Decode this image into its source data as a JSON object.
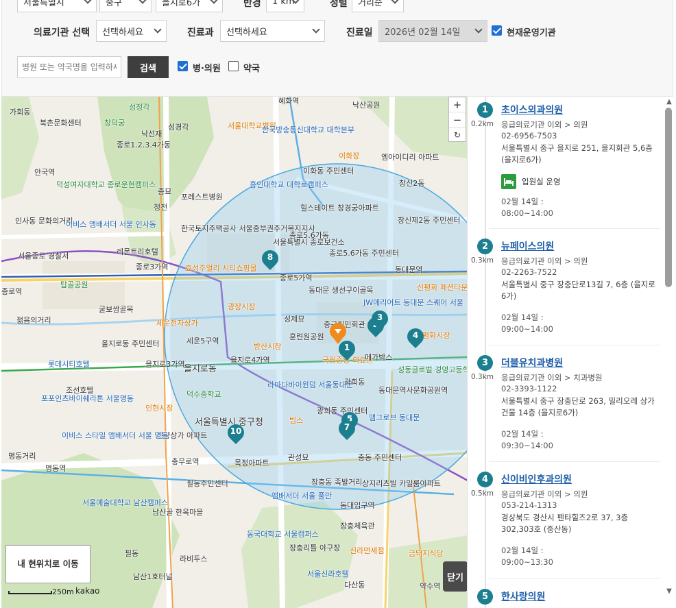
{
  "filters": {
    "region_city": "서울특별시",
    "region_district": "중구",
    "region_dong": "을지로6가",
    "radius_label": "반경",
    "radius_value": "1 km",
    "sort_label": "정렬",
    "sort_value": "거리순",
    "institution_label": "의료기관 선택",
    "institution_value": "선택하세요",
    "department_label": "진료과",
    "department_value": "선택하세요",
    "date_label": "진료일",
    "date_value": "2026년 02월 14일",
    "open_now_label": "현재운영기관",
    "open_now_checked": true,
    "search_placeholder": "병원 또는 약국명을 입력하세요",
    "search_button": "검색",
    "hospital_label": "병·의원",
    "hospital_checked": true,
    "pharmacy_label": "약국",
    "pharmacy_checked": false
  },
  "map": {
    "zoom_in": "+",
    "zoom_out": "−",
    "reset": "↻",
    "my_location": "내 현위치로 이동",
    "scale": "250m",
    "provider": "kakao",
    "close": "닫기",
    "labels": [
      "가회동",
      "북촌문화센터",
      "성정각",
      "창덕궁",
      "낙선재",
      "성경각",
      "서울대학교병원",
      "한국방송통신대학교 대학본부",
      "혜화역",
      "낙산공원",
      "종로1.2.3.4가동",
      "안국역",
      "덕성여자대학교 종로운현캠퍼스",
      "종묘",
      "포레스트병원",
      "정전",
      "이화동 주민센터",
      "이화장",
      "엠아이디리 아파트",
      "창신2동",
      "흥인대학교 대학로캠퍼스",
      "힐스테이트 창경궁아파트",
      "인사동 문화의거리",
      "이비스 앰배서더 서울 인사동",
      "한국토지주택공사 서울중부권주거복지지사",
      "종로5.6가동",
      "서울특별시 종로보건소",
      "종로5.6가동 주민센터",
      "창신제2동 주민센터",
      "서울종로 경찰서",
      "레몬트리호텔",
      "종로3가역",
      "효성주얼리 시티쇼핑몰",
      "종로5가역",
      "동대문역",
      "탑골공원",
      "굴보쌈골목",
      "동대문 생선구이골목",
      "광장시장",
      "JW메리어트 동대문 스퀘어 서울",
      "신평화 패션타운",
      "젊음의거리",
      "세운전자상가",
      "성제묘",
      "종로역",
      "중구립민회관",
      "평화시장",
      "세운5구역",
      "방산시장",
      "훈련원공원",
      "을지로동 주민센터",
      "을지로3가역",
      "을지로4가역",
      "국립중앙 의료원",
      "메가박스",
      "롯데시티호텔",
      "조선호텔",
      "포포인츠바이쉐라톤 서울명동",
      "을지로동",
      "라마다바이윈덤 서울동대문",
      "광희동",
      "동대문역사문화공원역",
      "성동글로벌 경영고등학교",
      "덕수중학교",
      "인현시장",
      "서울특별시 중구청",
      "진양상가 아파트",
      "빕스",
      "광희동 주민센터",
      "앰그로브 동대문",
      "명동거리",
      "이비스 스타일 앰배서더 서울 명동",
      "충무로역",
      "관성묘",
      "목정아파트",
      "충동 주민센터",
      "명동역",
      "필동주민센터",
      "상지리츠빌 카일룸아파트",
      "장충동 족발거리",
      "동대입구역",
      "서울예술대학교 남산캠퍼스",
      "남산골 한옥마을",
      "앰배서더 서울 풀만",
      "동국대학교 서울캠퍼스",
      "장충체육관",
      "장충리틀 야구장",
      "신라면세점",
      "금돼지식당",
      "필동",
      "라비두스",
      "남산1호터널",
      "다산동",
      "약수역",
      "서울신라호텔"
    ]
  },
  "results": [
    {
      "index": "1",
      "distance": "0.2km",
      "name": "초이스외과의원",
      "category": "응급의료기관 이외 > 의원",
      "phone": "02-6956-7503",
      "address": "서울특별시 중구 을지로 251, 을지회관 5,6층 (을지로6가)",
      "inpatient": "입원실 운영",
      "hours_date": "02월 14일 :",
      "hours": "08:00~14:00"
    },
    {
      "index": "2",
      "distance": "0.3km",
      "name": "뉴페이스의원",
      "category": "응급의료기관 이외 > 의원",
      "phone": "02-2263-7522",
      "address": "서울특별시 중구 장충단로13길 7, 6층 (을지로6가)",
      "hours_date": "02월 14일 :",
      "hours": "09:00~14:00"
    },
    {
      "index": "3",
      "distance": "0.3km",
      "name": "더블유치과병원",
      "category": "응급의료기관 이외 > 치과병원",
      "phone": "02-3393-1122",
      "address": "서울특별시 중구 장충단로 263, 밀리오레 상가건물 14층 (을지로6가)",
      "hours_date": "02월 14일 :",
      "hours": "09:30~14:00"
    },
    {
      "index": "4",
      "distance": "0.5km",
      "name": "신이비인후과의원",
      "category": "응급의료기관 이외 > 의원",
      "phone": "053-214-1313",
      "address": "경상북도 경산시 펜타힐즈2로 37, 3층 302,303호 (중산동)",
      "hours_date": "02월 14일 :",
      "hours": "09:00~13:30"
    },
    {
      "index": "5",
      "name": "한사랑의원"
    }
  ],
  "colors": {
    "accent": "#1b7f8f",
    "link": "#1f5fa8",
    "search_button": "#3e3e3e",
    "checkbox": "#1f6fd4",
    "radius_circle": "#4aa8e0",
    "current_marker": "#f08a1c"
  }
}
